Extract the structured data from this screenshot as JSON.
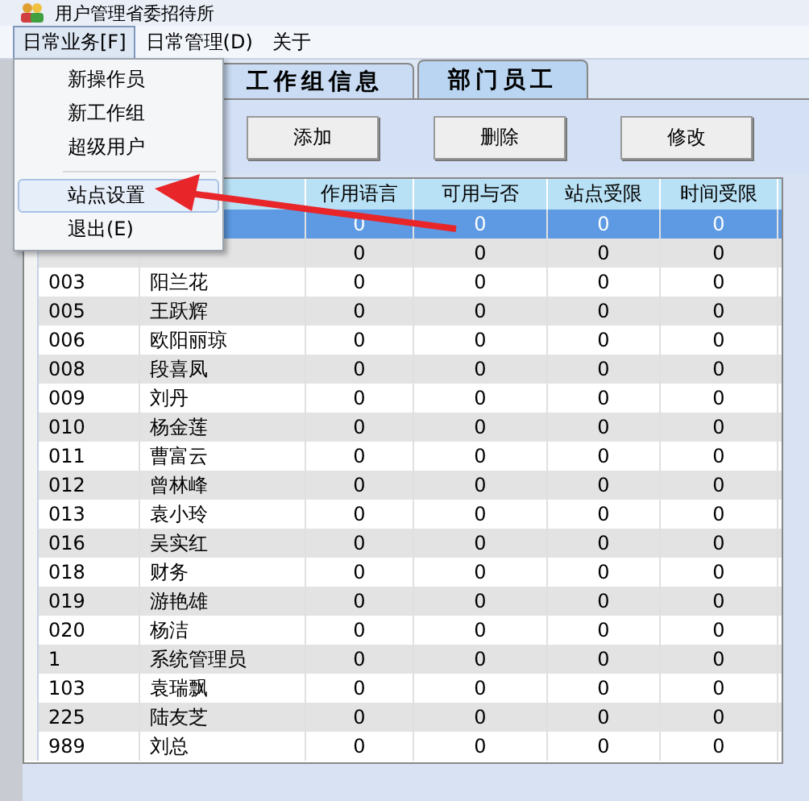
{
  "window": {
    "title": "用户管理省委招待所"
  },
  "menu_bar": [
    {
      "label": "日常业务[F]",
      "selected": true
    },
    {
      "label": "日常管理(D)",
      "selected": false
    },
    {
      "label": "关于",
      "selected": false
    }
  ],
  "open_menu": {
    "items": [
      {
        "kind": "item",
        "label": "新操作员",
        "selected": false
      },
      {
        "kind": "item",
        "label": "新工作组",
        "selected": false
      },
      {
        "kind": "item",
        "label": "超级用户",
        "selected": false
      },
      {
        "kind": "separator"
      },
      {
        "kind": "item",
        "label": "站点设置",
        "selected": true
      },
      {
        "kind": "item",
        "label": "退出(E)",
        "selected": false
      }
    ]
  },
  "tabs": [
    {
      "label": "工作组信息",
      "selected": false
    },
    {
      "label": "部门员工",
      "selected": true
    }
  ],
  "buttons": [
    "添加",
    "删除",
    "修改"
  ],
  "table": {
    "columns": [
      "",
      "",
      "作用语言",
      "可用与否",
      "站点受限",
      "时间受限"
    ],
    "rows": [
      {
        "cells": [
          "",
          "",
          "0",
          "0",
          "0",
          "0"
        ],
        "selected": true
      },
      {
        "cells": [
          "",
          "",
          "0",
          "0",
          "0",
          "0"
        ],
        "selected": false
      },
      {
        "cells": [
          "003",
          "阳兰花",
          "0",
          "0",
          "0",
          "0"
        ],
        "selected": false
      },
      {
        "cells": [
          "005",
          "王跃辉",
          "0",
          "0",
          "0",
          "0"
        ],
        "selected": false
      },
      {
        "cells": [
          "006",
          "欧阳丽琼",
          "0",
          "0",
          "0",
          "0"
        ],
        "selected": false
      },
      {
        "cells": [
          "008",
          "段喜凤",
          "0",
          "0",
          "0",
          "0"
        ],
        "selected": false
      },
      {
        "cells": [
          "009",
          "刘丹",
          "0",
          "0",
          "0",
          "0"
        ],
        "selected": false
      },
      {
        "cells": [
          "010",
          "杨金莲",
          "0",
          "0",
          "0",
          "0"
        ],
        "selected": false
      },
      {
        "cells": [
          "011",
          "曹富云",
          "0",
          "0",
          "0",
          "0"
        ],
        "selected": false
      },
      {
        "cells": [
          "012",
          "曾林峰",
          "0",
          "0",
          "0",
          "0"
        ],
        "selected": false
      },
      {
        "cells": [
          "013",
          "袁小玲",
          "0",
          "0",
          "0",
          "0"
        ],
        "selected": false
      },
      {
        "cells": [
          "016",
          "吴实红",
          "0",
          "0",
          "0",
          "0"
        ],
        "selected": false
      },
      {
        "cells": [
          "018",
          "财务",
          "0",
          "0",
          "0",
          "0"
        ],
        "selected": false
      },
      {
        "cells": [
          "019",
          "游艳雄",
          "0",
          "0",
          "0",
          "0"
        ],
        "selected": false
      },
      {
        "cells": [
          "020",
          "杨洁",
          "0",
          "0",
          "0",
          "0"
        ],
        "selected": false
      },
      {
        "cells": [
          "1",
          "系统管理员",
          "0",
          "0",
          "0",
          "0"
        ],
        "selected": false
      },
      {
        "cells": [
          "103",
          "袁瑞飘",
          "0",
          "0",
          "0",
          "0"
        ],
        "selected": false
      },
      {
        "cells": [
          "225",
          "陆友芝",
          "0",
          "0",
          "0",
          "0"
        ],
        "selected": false
      },
      {
        "cells": [
          "989",
          "刘总",
          "0",
          "0",
          "0",
          "0"
        ],
        "selected": false
      }
    ]
  }
}
